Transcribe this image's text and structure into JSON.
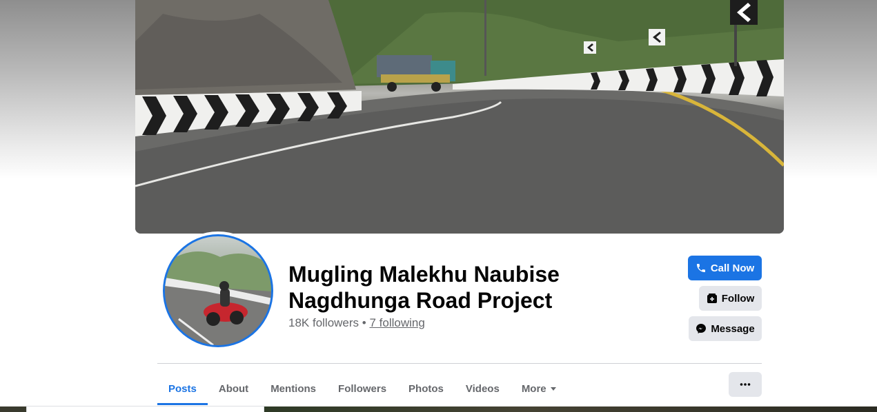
{
  "page": {
    "name": "Mugling Malekhu Naubise Nagdhunga Road Project",
    "followers_text": "18K followers",
    "separator": "•",
    "following_text": "7 following"
  },
  "actions": {
    "call_now": "Call Now",
    "follow": "Follow",
    "message": "Message",
    "more_options": "···"
  },
  "tabs": [
    {
      "label": "Posts",
      "active": true
    },
    {
      "label": "About"
    },
    {
      "label": "Mentions"
    },
    {
      "label": "Followers"
    },
    {
      "label": "Photos"
    },
    {
      "label": "Videos"
    },
    {
      "label": "More",
      "has_dropdown": true
    }
  ],
  "colors": {
    "accent": "#1b74e4",
    "text": "#050505",
    "muted": "#65676b",
    "secondary_button": "#e4e6eb"
  },
  "icons": {
    "call": "phone-icon",
    "follow": "follow-icon",
    "message": "messenger-icon",
    "more": "ellipsis-icon",
    "dropdown": "caret-down-icon"
  }
}
